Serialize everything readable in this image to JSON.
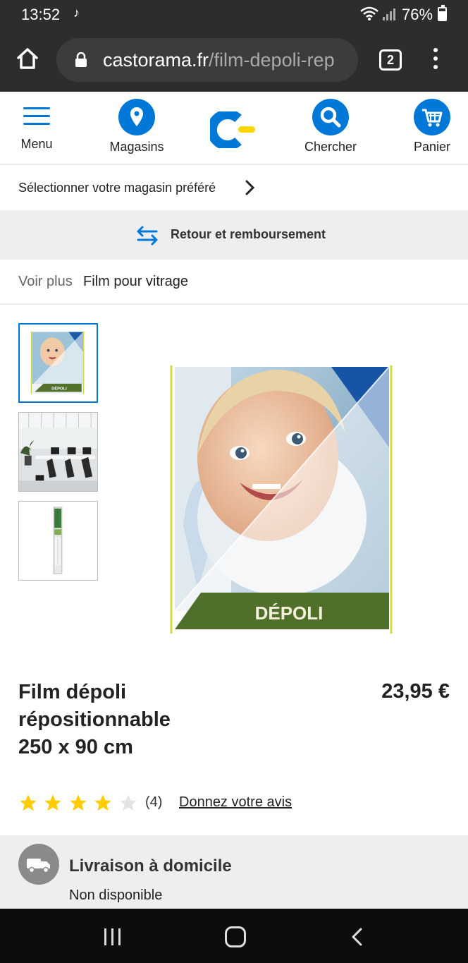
{
  "status_bar": {
    "time": "13:52",
    "tiktok_icon": "tiktok-icon",
    "battery_text": "76%",
    "battery_level": 0.76
  },
  "browser": {
    "url_domain": "castorama.fr",
    "url_path": "/film-depoli-rep",
    "tab_count": "2"
  },
  "header": {
    "menu_label": "Menu",
    "magasins_label": "Magasins",
    "chercher_label": "Chercher",
    "panier_label": "Panier",
    "accent_color": "#0078d7",
    "logo_accent": "#ffd500"
  },
  "store": {
    "label": "Sélectionner votre magasin préféré"
  },
  "return_banner": {
    "label": "Retour et remboursement"
  },
  "breadcrumb": {
    "prefix": "Voir plus",
    "link": "Film pour vitrage"
  },
  "gallery": {
    "thumb_badge": "DÉPOLI",
    "main_badge": "DÉPOLI"
  },
  "product": {
    "title_line1": "Film dépoli",
    "title_line2": "répositionnable",
    "title_line3": "250 x 90 cm",
    "price": "23,95 €",
    "rating": 4,
    "rating_max": 5,
    "review_count": "(4)",
    "review_link": "Donnez votre avis"
  },
  "delivery": {
    "title": "Livraison à domicile",
    "status": "Non disponible"
  }
}
